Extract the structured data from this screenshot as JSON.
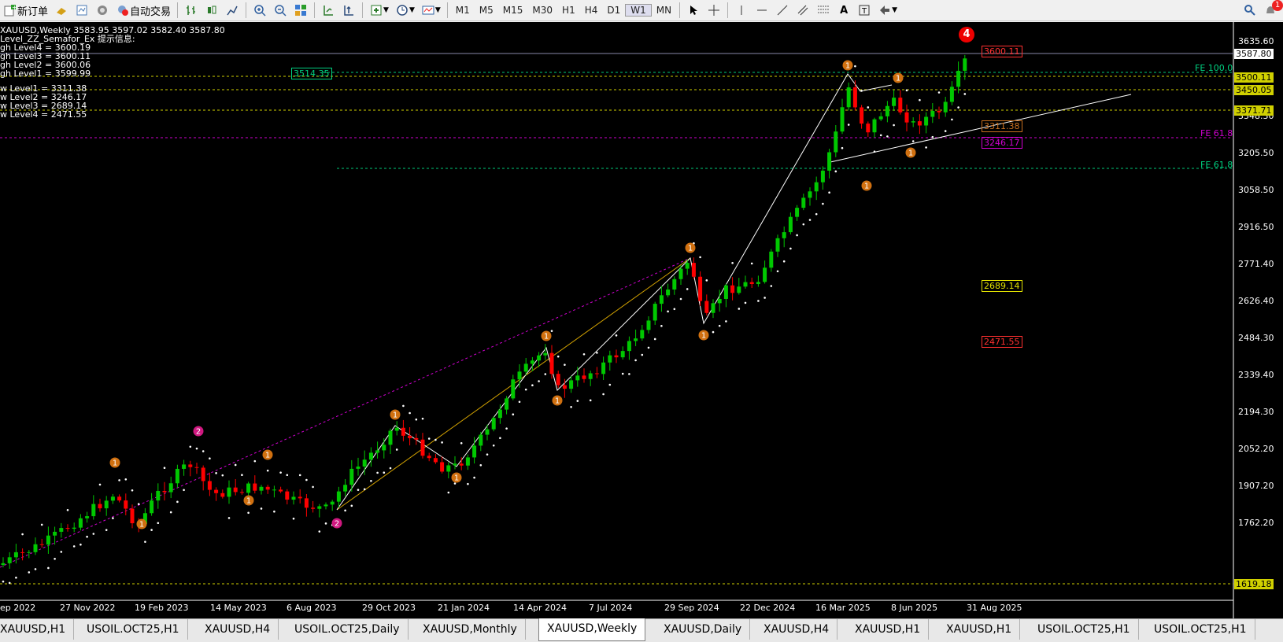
{
  "toolbar": {
    "new_order": "新订单",
    "auto_trading": "自动交易",
    "timeframes": [
      "M1",
      "M5",
      "M15",
      "M30",
      "H1",
      "H4",
      "D1",
      "W1",
      "MN"
    ]
  },
  "chart_info": {
    "title": "XAUUSD,Weekly  3583.95 3597.02 3582.40 3587.80",
    "indicator": "Level_ZZ_Semafor_Ex 提示信息:",
    "levels": [
      "gh Level4 = 3600.19",
      "gh Level3 = 3600.11",
      "gh Level2 = 3600.06",
      "gh Level1 = 3599.99",
      "w Level1 = 3311.38",
      "w Level2 = 3246.17",
      "w Level3 = 2689.14",
      "w Level4 = 2471.55"
    ]
  },
  "y_axis": [
    "3635.60",
    "3490.45",
    "3348.30",
    "3205.50",
    "3058.50",
    "2916.50",
    "2771.40",
    "2626.40",
    "2484.30",
    "2339.40",
    "2194.30",
    "2052.20",
    "1907.20",
    "1762.20"
  ],
  "x_axis": [
    "ep 2022",
    "27 Nov 2022",
    "19 Feb 2023",
    "14 May 2023",
    "6 Aug 2023",
    "29 Oct 2023",
    "21 Jan 2024",
    "14 Apr 2024",
    "7 Jul 2024",
    "29 Sep 2024",
    "22 Dec 2024",
    "16 Mar 2025",
    "8 Jun 2025",
    "31 Aug 2025"
  ],
  "price_labels": {
    "current": "3587.80",
    "l3500": "3500.11",
    "l3450": "3450.05",
    "l3371": "3371.71",
    "l1619": "1619.18",
    "top": "3600.11",
    "low1": "3311.38",
    "low2": "3246.17",
    "low3": "2689.14",
    "low4": "2471.55",
    "box3514": "3514.35",
    "fe100": "FE 100.0",
    "fe618a": "FE 61.8",
    "fe618b": "FE 61.8",
    "marker_red": "4",
    "notification_count": "1"
  },
  "tabs": [
    "XAUUSD,H1",
    "USOIL.OCT25,H1",
    "XAUUSD,H4",
    "USOIL.OCT25,Daily",
    "XAUUSD,Monthly",
    "XAUUSD,Weekly",
    "XAUUSD,Daily",
    "XAUUSD,H4",
    "XAUUSD,H1",
    "XAUUSD,H1",
    "USOIL.OCT25,H1",
    "USOIL.OCT25,H1"
  ],
  "active_tab_index": 5,
  "colors": {
    "up": "#00c800",
    "down": "#ff0000",
    "bg": "#000000",
    "grid": "#ffffff"
  },
  "chart_data": {
    "type": "candlestick",
    "symbol": "XAUUSD",
    "timeframe": "Weekly",
    "last_ohlc": {
      "open": 3583.95,
      "high": 3597.02,
      "low": 3582.4,
      "close": 3587.8
    },
    "ylim": [
      1619.18,
      3635.6
    ],
    "semafor_markers": [
      {
        "label": "1",
        "price": 1950
      },
      {
        "label": "2",
        "price": 2070
      },
      {
        "label": "1",
        "price": 2150
      },
      {
        "label": "1",
        "price": 2430
      },
      {
        "label": "1",
        "price": 2780
      },
      {
        "label": "1",
        "price": 3500
      },
      {
        "label": "1",
        "price": 3500
      },
      {
        "label": "4",
        "price": 3600
      }
    ]
  }
}
